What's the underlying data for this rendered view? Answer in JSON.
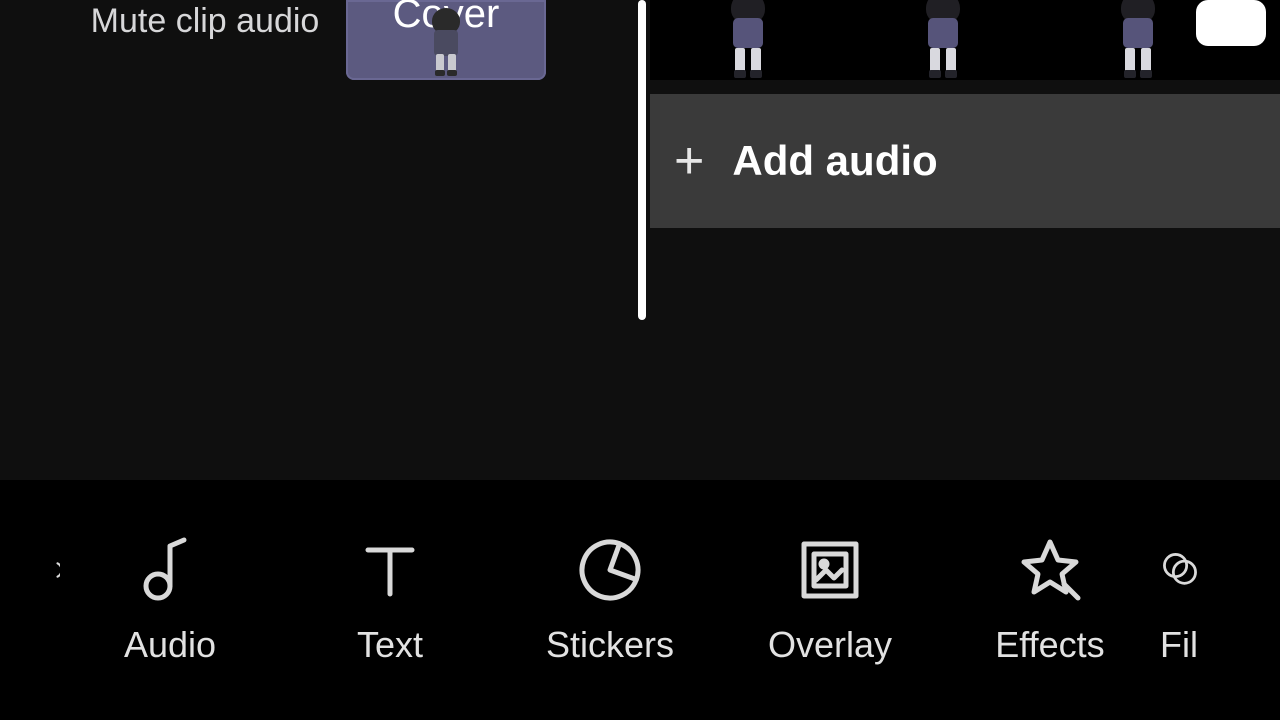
{
  "timeline": {
    "mute_label": "Mute clip audio",
    "cover_label": "Cover",
    "add_audio_label": "Add audio"
  },
  "toolbar": {
    "items": [
      {
        "label": "Audio",
        "icon": "music-note-icon"
      },
      {
        "label": "Text",
        "icon": "text-icon"
      },
      {
        "label": "Stickers",
        "icon": "sticker-icon"
      },
      {
        "label": "Overlay",
        "icon": "overlay-icon"
      },
      {
        "label": "Effects",
        "icon": "effects-icon"
      },
      {
        "label": "Fil",
        "icon": "filter-icon"
      }
    ]
  }
}
